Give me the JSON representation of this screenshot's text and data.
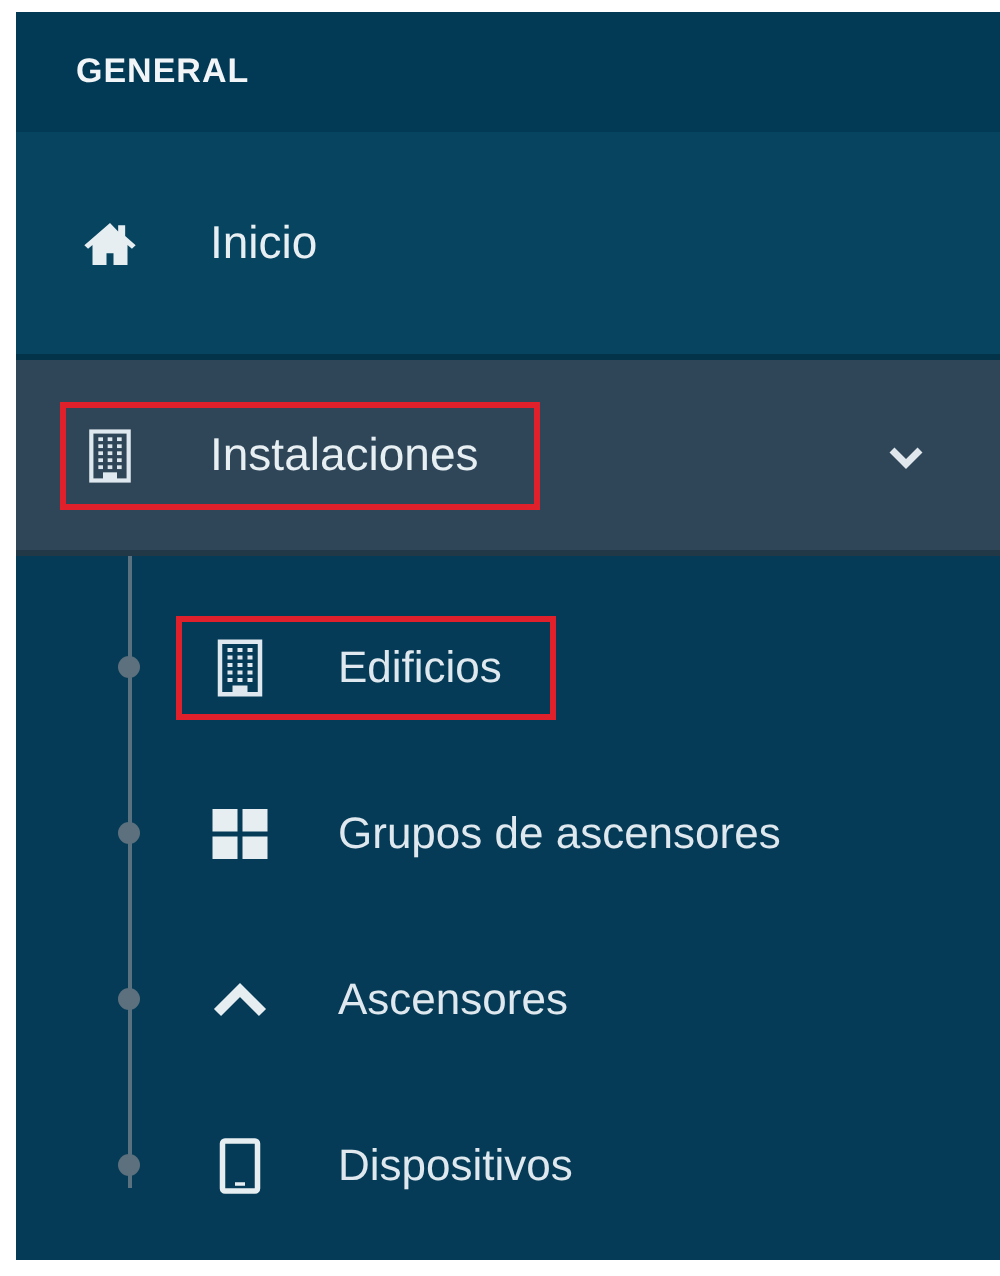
{
  "sidebar": {
    "section_title": "GENERAL",
    "items": [
      {
        "label": "Inicio",
        "kind": "home",
        "highlighted": false,
        "expanded": false,
        "has_children": false
      },
      {
        "label": "Instalaciones",
        "kind": "building",
        "highlighted": true,
        "expanded": true,
        "has_children": true,
        "children": [
          {
            "label": "Edificios",
            "kind": "building",
            "highlighted": true
          },
          {
            "label": "Grupos de ascensores",
            "kind": "grid",
            "highlighted": false
          },
          {
            "label": "Ascensores",
            "kind": "chevron-up",
            "highlighted": false
          },
          {
            "label": "Dispositivos",
            "kind": "tablet",
            "highlighted": false
          }
        ]
      }
    ]
  }
}
